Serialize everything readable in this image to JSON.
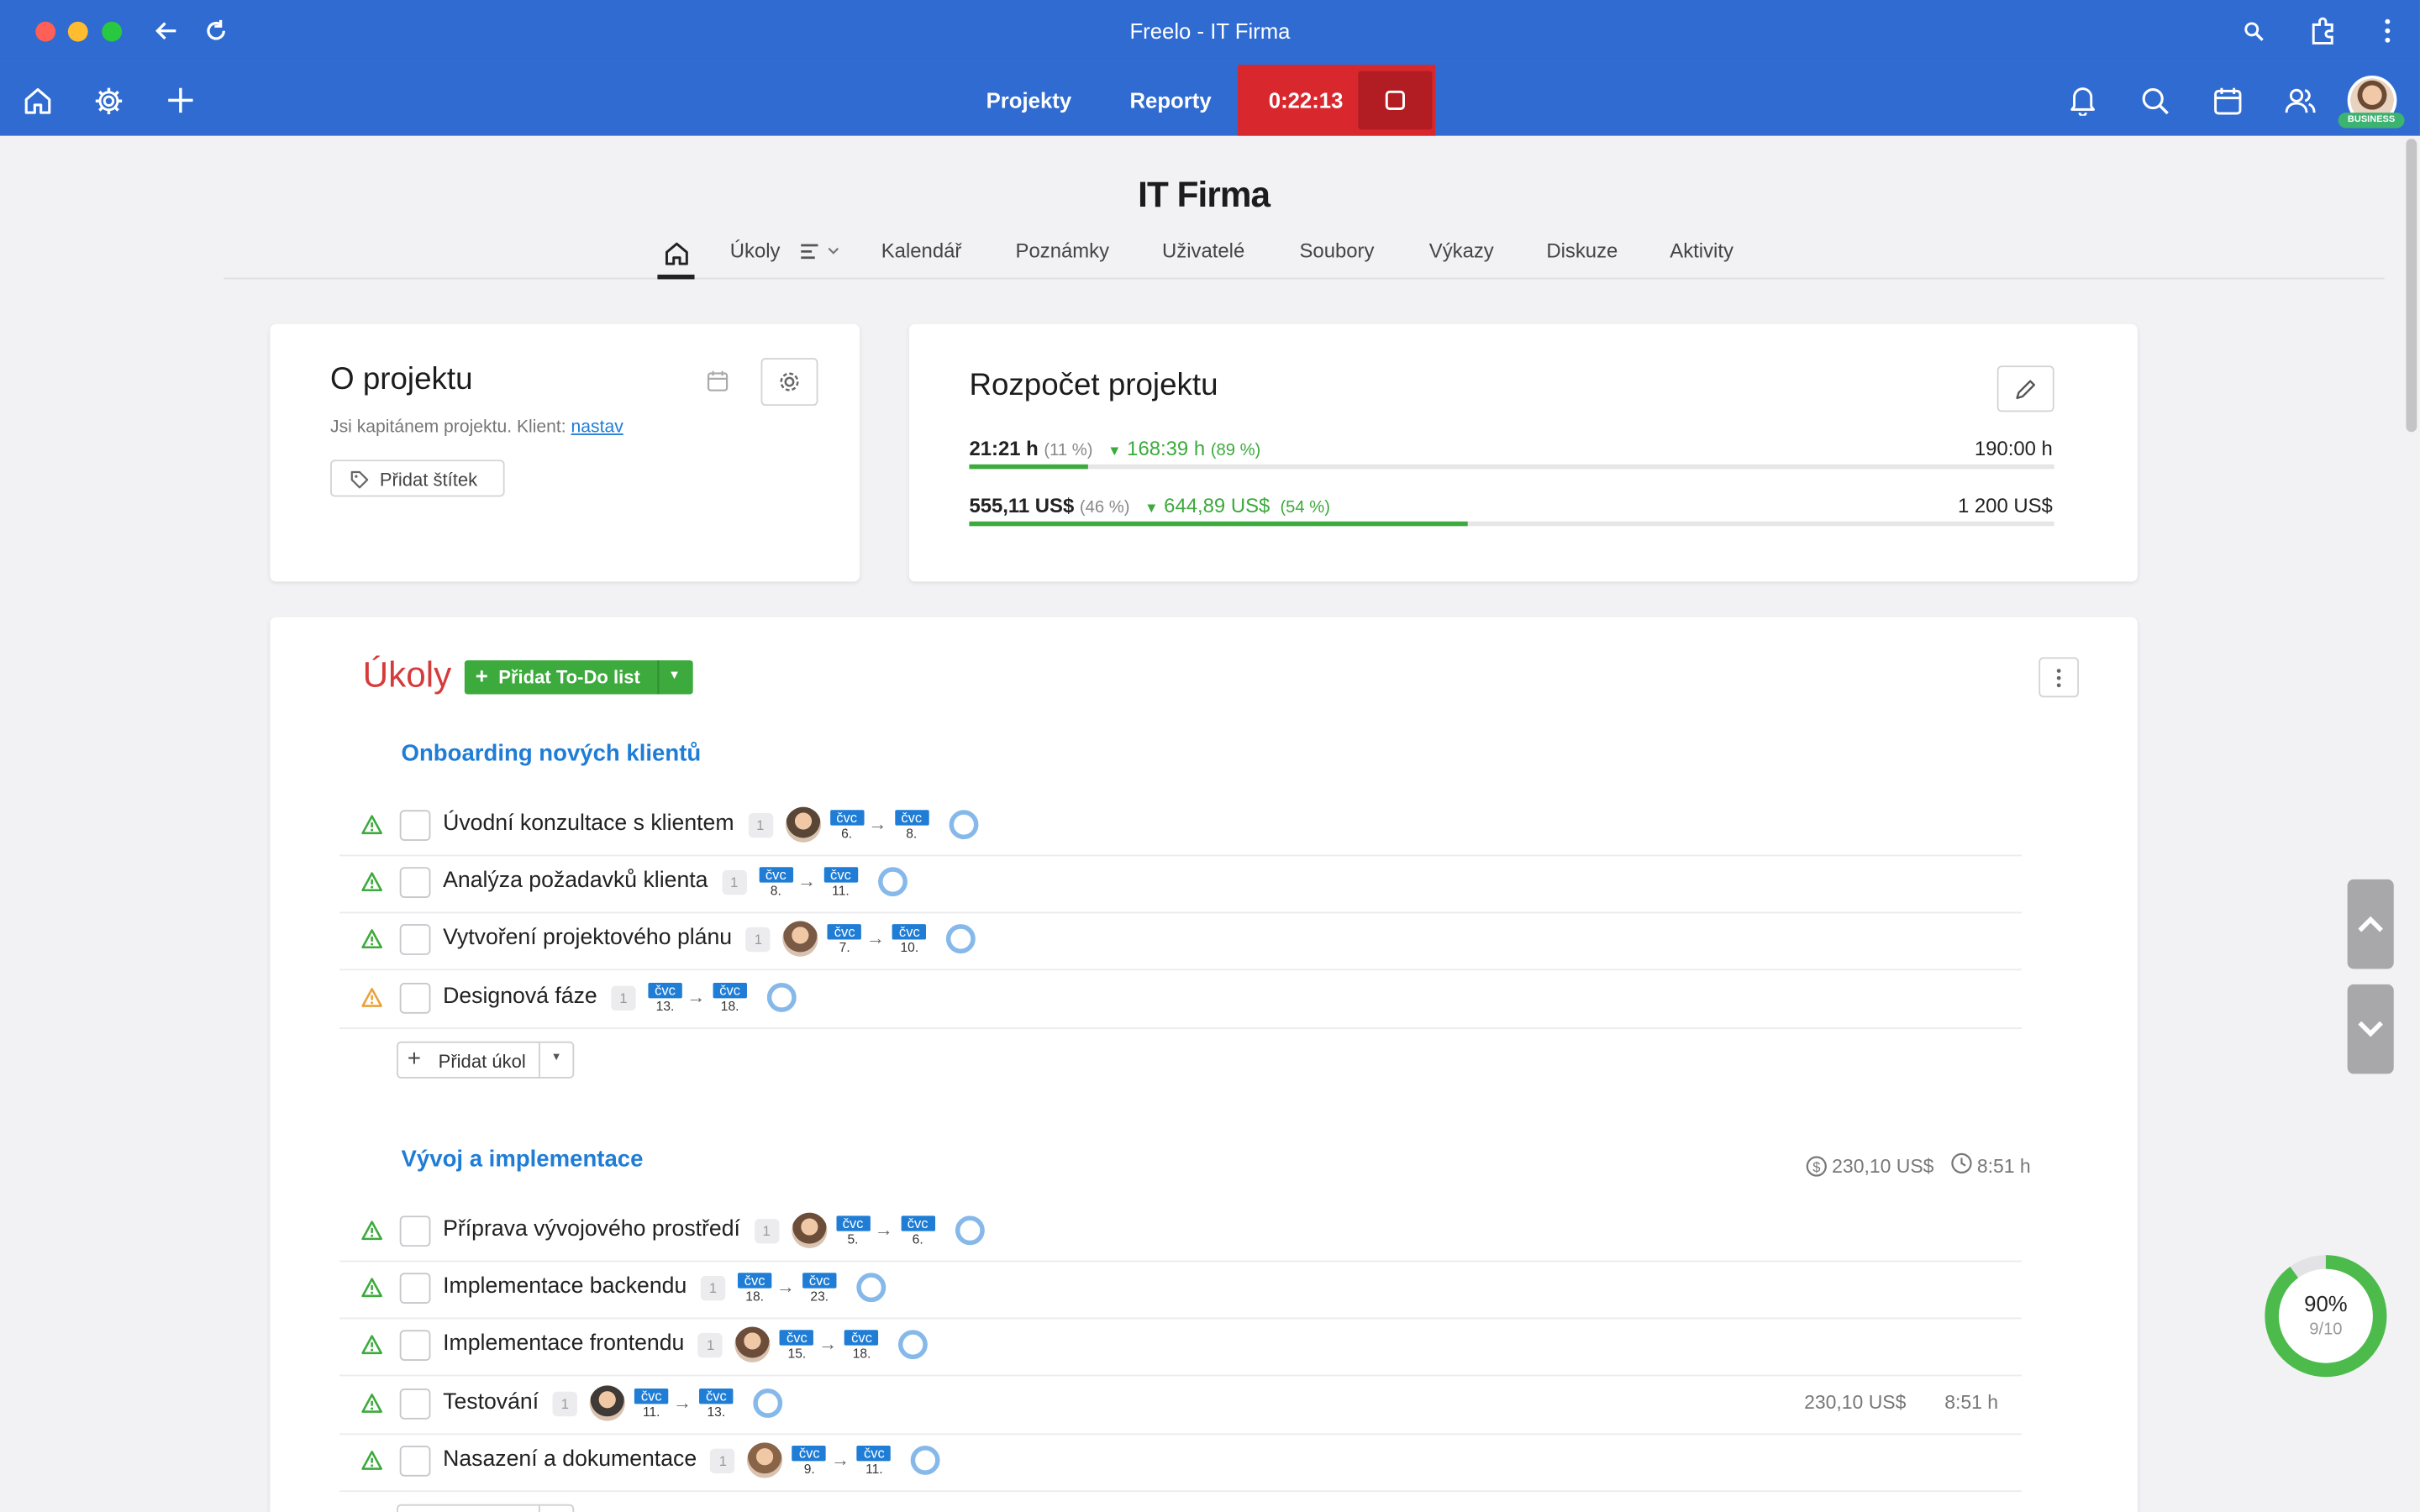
{
  "window": {
    "title": "Freelo - IT Firma"
  },
  "nav": {
    "projects": "Projekty",
    "reports": "Reporty",
    "timer": "0:22:13",
    "badge": "BUSINESS"
  },
  "project": {
    "title": "IT Firma",
    "tabs": [
      "Úkoly",
      "Kalendář",
      "Poznámky",
      "Uživatelé",
      "Soubory",
      "Výkazy",
      "Diskuze",
      "Aktivity"
    ]
  },
  "about": {
    "title": "O projektu",
    "desc": "Jsi kapitánem projektu. Klient: ",
    "client_link": "nastav",
    "add_tag": "Přidat štítek"
  },
  "budget": {
    "title": "Rozpočet projektu",
    "time": {
      "used": "21:21 h",
      "used_pct": "(11 %)",
      "left": "168:39 h",
      "left_pct": "(89 %)",
      "total": "190:00 h",
      "fill": 0.11
    },
    "money": {
      "used": "555,11 US$",
      "used_pct": "(46 %)",
      "left": "644,89 US$",
      "left_pct": "(54 %)",
      "total": "1 200 US$",
      "fill": 0.46
    }
  },
  "tasks": {
    "title": "Úkoly",
    "add_todo": "Přidat To-Do list",
    "add_task": "Přidat úkol",
    "lists": [
      {
        "name": "Onboarding nových klientů",
        "items": [
          {
            "name": "Úvodní konzultace s klientem",
            "count": "1",
            "from": {
              "m": "čvc",
              "d": "6."
            },
            "to": {
              "m": "čvc",
              "d": "8."
            }
          },
          {
            "name": "Analýza požadavků klienta",
            "count": "1",
            "from": {
              "m": "čvc",
              "d": "8."
            },
            "to": {
              "m": "čvc",
              "d": "11."
            }
          },
          {
            "name": "Vytvoření projektového plánu",
            "count": "1",
            "from": {
              "m": "čvc",
              "d": "7."
            },
            "to": {
              "m": "čvc",
              "d": "10."
            }
          },
          {
            "name": "Designová fáze",
            "count": "1",
            "from": {
              "m": "čvc",
              "d": "13."
            },
            "to": {
              "m": "čvc",
              "d": "18."
            }
          }
        ]
      },
      {
        "name": "Vývoj a implementace",
        "cost": "230,10 US$",
        "time": "8:51 h",
        "items": [
          {
            "name": "Příprava vývojového prostředí",
            "count": "1",
            "from": {
              "m": "čvc",
              "d": "5."
            },
            "to": {
              "m": "čvc",
              "d": "6."
            }
          },
          {
            "name": "Implementace backendu",
            "count": "1",
            "from": {
              "m": "čvc",
              "d": "18."
            },
            "to": {
              "m": "čvc",
              "d": "23."
            }
          },
          {
            "name": "Implementace frontendu",
            "count": "1",
            "from": {
              "m": "čvc",
              "d": "15."
            },
            "to": {
              "m": "čvc",
              "d": "18."
            }
          },
          {
            "name": "Testování",
            "count": "1",
            "from": {
              "m": "čvc",
              "d": "11."
            },
            "to": {
              "m": "čvc",
              "d": "13."
            },
            "cost": "230,10 US$",
            "time": "8:51 h"
          },
          {
            "name": "Nasazení a dokumentace",
            "count": "1",
            "from": {
              "m": "čvc",
              "d": "9."
            },
            "to": {
              "m": "čvc",
              "d": "11."
            }
          }
        ]
      }
    ]
  },
  "progress": {
    "percent": "90%",
    "ratio": "9/10",
    "fill": 0.9
  },
  "colors": {
    "brand": "#2f6bd0",
    "timer": "#d9272e",
    "accent_green": "#3caa3c",
    "link": "#1f7dd6",
    "alert_red": "#d33"
  }
}
